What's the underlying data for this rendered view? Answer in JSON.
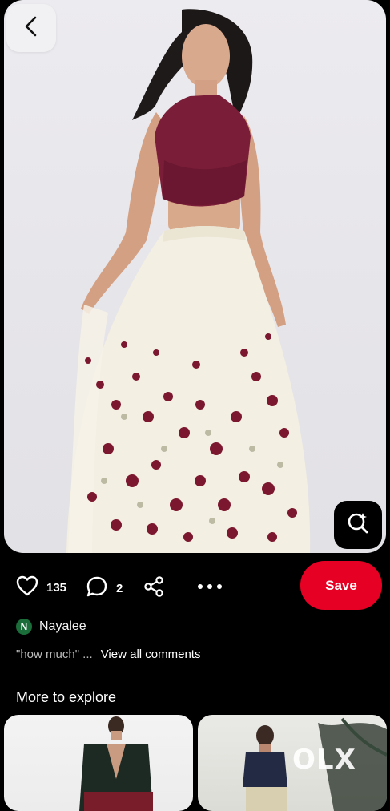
{
  "pin": {
    "image_alt": "Model in maroon halter crop top and ivory floral embroidered lehenga skirt"
  },
  "actions": {
    "likes_count": "135",
    "comments_count": "2",
    "save_label": "Save"
  },
  "uploader": {
    "avatar_letter": "N",
    "name": "Nayalee"
  },
  "comments": {
    "preview": "\"how much\" ...",
    "view_all": "View all comments"
  },
  "explore": {
    "title": "More to explore",
    "watermark": "OLX"
  },
  "colors": {
    "save": "#e60023",
    "background": "#000000",
    "top_maroon": "#7a1d38",
    "skirt_ivory": "#f3efe2",
    "avatar_green": "#1b6e3a"
  },
  "icons": [
    "back-chevron-icon",
    "visual-search-icon",
    "heart-icon",
    "comment-icon",
    "share-icon",
    "more-icon"
  ]
}
